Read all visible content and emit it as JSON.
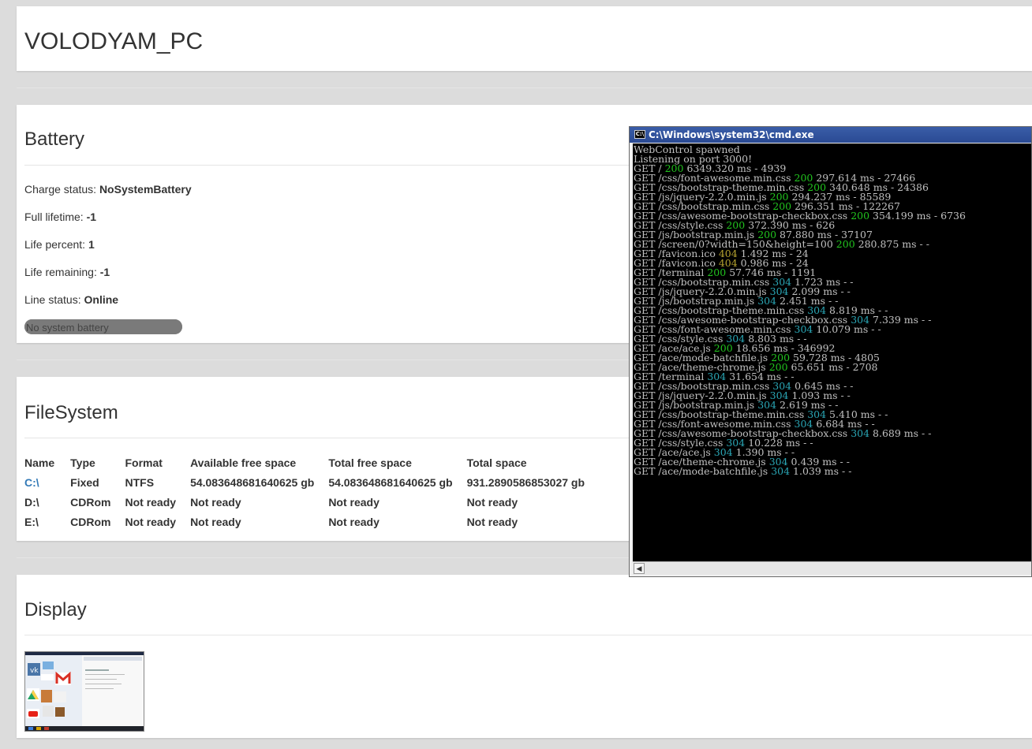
{
  "header": {
    "title": "VOLODYAM_PC"
  },
  "battery": {
    "heading": "Battery",
    "fields": [
      {
        "label": "Charge status: ",
        "value": "NoSystemBattery"
      },
      {
        "label": "Full lifetime: ",
        "value": "-1"
      },
      {
        "label": "Life percent: ",
        "value": "1"
      },
      {
        "label": "Life remaining: ",
        "value": "-1"
      },
      {
        "label": "Line status: ",
        "value": "Online"
      }
    ],
    "progress_label": "No system battery",
    "progress_fraction": 1.0
  },
  "filesystem": {
    "heading": "FileSystem",
    "columns": [
      "Name",
      "Type",
      "Format",
      "Available free space",
      "Total free space",
      "Total space"
    ],
    "rows": [
      [
        "C:\\",
        "Fixed",
        "NTFS",
        "54.083648681640625 gb",
        "54.083648681640625 gb",
        "931.2890586853027 gb"
      ],
      [
        "D:\\",
        "CDRom",
        "Not ready",
        "Not ready",
        "Not ready",
        "Not ready"
      ],
      [
        "E:\\",
        "CDRom",
        "Not ready",
        "Not ready",
        "Not ready",
        "Not ready"
      ]
    ]
  },
  "display": {
    "heading": "Display"
  },
  "cmd": {
    "title": "C:\\Windows\\system32\\cmd.exe",
    "icon": "cmd-icon",
    "lines": [
      [
        {
          "t": "WebControl spawned"
        }
      ],
      [
        {
          "t": "Listening on port 3000!"
        }
      ],
      [
        {
          "t": "GET / "
        },
        {
          "t": "200",
          "c": "green"
        },
        {
          "t": " 6349.320 ms - 4939"
        }
      ],
      [
        {
          "t": "GET /css/font-awesome.min.css "
        },
        {
          "t": "200",
          "c": "green"
        },
        {
          "t": " 297.614 ms - 27466"
        }
      ],
      [
        {
          "t": "GET /css/bootstrap-theme.min.css "
        },
        {
          "t": "200",
          "c": "green"
        },
        {
          "t": " 340.648 ms - 24386"
        }
      ],
      [
        {
          "t": "GET /js/jquery-2.2.0.min.js "
        },
        {
          "t": "200",
          "c": "green"
        },
        {
          "t": " 294.237 ms - 85589"
        }
      ],
      [
        {
          "t": "GET /css/bootstrap.min.css "
        },
        {
          "t": "200",
          "c": "green"
        },
        {
          "t": " 296.351 ms - 122267"
        }
      ],
      [
        {
          "t": "GET /css/awesome-bootstrap-checkbox.css "
        },
        {
          "t": "200",
          "c": "green"
        },
        {
          "t": " 354.199 ms - 6736"
        }
      ],
      [
        {
          "t": "GET /css/style.css "
        },
        {
          "t": "200",
          "c": "green"
        },
        {
          "t": " 372.390 ms - 626"
        }
      ],
      [
        {
          "t": "GET /js/bootstrap.min.js "
        },
        {
          "t": "200",
          "c": "green"
        },
        {
          "t": " 87.880 ms - 37107"
        }
      ],
      [
        {
          "t": "GET /screen/0?width=150&height=100 "
        },
        {
          "t": "200",
          "c": "green"
        },
        {
          "t": " 280.875 ms - -"
        }
      ],
      [
        {
          "t": "GET /favicon.ico "
        },
        {
          "t": "404",
          "c": "yellow"
        },
        {
          "t": " 1.492 ms - 24"
        }
      ],
      [
        {
          "t": "GET /favicon.ico "
        },
        {
          "t": "404",
          "c": "yellow"
        },
        {
          "t": " 0.986 ms - 24"
        }
      ],
      [
        {
          "t": "GET /terminal "
        },
        {
          "t": "200",
          "c": "green"
        },
        {
          "t": " 57.746 ms - 1191"
        }
      ],
      [
        {
          "t": "GET /css/bootstrap.min.css "
        },
        {
          "t": "304",
          "c": "cyan"
        },
        {
          "t": " 1.723 ms - -"
        }
      ],
      [
        {
          "t": "GET /js/jquery-2.2.0.min.js "
        },
        {
          "t": "304",
          "c": "cyan"
        },
        {
          "t": " 2.099 ms - -"
        }
      ],
      [
        {
          "t": "GET /js/bootstrap.min.js "
        },
        {
          "t": "304",
          "c": "cyan"
        },
        {
          "t": " 2.451 ms - -"
        }
      ],
      [
        {
          "t": "GET /css/bootstrap-theme.min.css "
        },
        {
          "t": "304",
          "c": "cyan"
        },
        {
          "t": " 8.819 ms - -"
        }
      ],
      [
        {
          "t": "GET /css/awesome-bootstrap-checkbox.css "
        },
        {
          "t": "304",
          "c": "cyan"
        },
        {
          "t": " 7.339 ms - -"
        }
      ],
      [
        {
          "t": "GET /css/font-awesome.min.css "
        },
        {
          "t": "304",
          "c": "cyan"
        },
        {
          "t": " 10.079 ms - -"
        }
      ],
      [
        {
          "t": "GET /css/style.css "
        },
        {
          "t": "304",
          "c": "cyan"
        },
        {
          "t": " 8.803 ms - -"
        }
      ],
      [
        {
          "t": "GET /ace/ace.js "
        },
        {
          "t": "200",
          "c": "green"
        },
        {
          "t": " 18.656 ms - 346992"
        }
      ],
      [
        {
          "t": "GET /ace/mode-batchfile.js "
        },
        {
          "t": "200",
          "c": "green"
        },
        {
          "t": " 59.728 ms - 4805"
        }
      ],
      [
        {
          "t": "GET /ace/theme-chrome.js "
        },
        {
          "t": "200",
          "c": "green"
        },
        {
          "t": " 65.651 ms - 2708"
        }
      ],
      [
        {
          "t": "GET /terminal "
        },
        {
          "t": "304",
          "c": "cyan"
        },
        {
          "t": " 31.654 ms - -"
        }
      ],
      [
        {
          "t": "GET /css/bootstrap.min.css "
        },
        {
          "t": "304",
          "c": "cyan"
        },
        {
          "t": " 0.645 ms - -"
        }
      ],
      [
        {
          "t": "GET /js/jquery-2.2.0.min.js "
        },
        {
          "t": "304",
          "c": "cyan"
        },
        {
          "t": " 1.093 ms - -"
        }
      ],
      [
        {
          "t": "GET /js/bootstrap.min.js "
        },
        {
          "t": "304",
          "c": "cyan"
        },
        {
          "t": " 2.619 ms - -"
        }
      ],
      [
        {
          "t": "GET /css/bootstrap-theme.min.css "
        },
        {
          "t": "304",
          "c": "cyan"
        },
        {
          "t": " 5.410 ms - -"
        }
      ],
      [
        {
          "t": "GET /css/font-awesome.min.css "
        },
        {
          "t": "304",
          "c": "cyan"
        },
        {
          "t": " 6.684 ms - -"
        }
      ],
      [
        {
          "t": "GET /css/awesome-bootstrap-checkbox.css "
        },
        {
          "t": "304",
          "c": "cyan"
        },
        {
          "t": " 8.689 ms - -"
        }
      ],
      [
        {
          "t": "GET /css/style.css "
        },
        {
          "t": "304",
          "c": "cyan"
        },
        {
          "t": " 10.228 ms - -"
        }
      ],
      [
        {
          "t": "GET /ace/ace.js "
        },
        {
          "t": "304",
          "c": "cyan"
        },
        {
          "t": " 1.390 ms - -"
        }
      ],
      [
        {
          "t": "GET /ace/theme-chrome.js "
        },
        {
          "t": "304",
          "c": "cyan"
        },
        {
          "t": " 0.439 ms - -"
        }
      ],
      [
        {
          "t": "GET /ace/mode-batchfile.js "
        },
        {
          "t": "304",
          "c": "cyan"
        },
        {
          "t": " 1.039 ms - -"
        }
      ]
    ]
  },
  "colors": {
    "status_ok": "#21c41e",
    "status_not_found": "#b6a330",
    "status_not_modified": "#2aa7b6",
    "link": "#337ab7"
  }
}
